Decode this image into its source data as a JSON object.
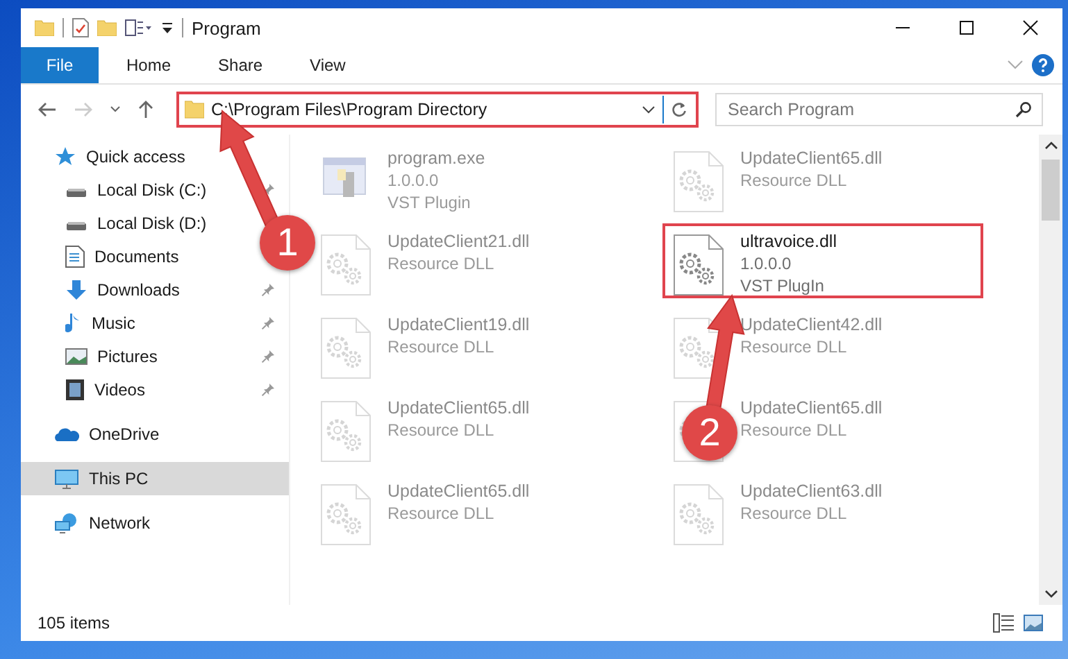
{
  "window": {
    "title": "Program"
  },
  "ribbon_tabs": [
    {
      "label": "File",
      "kind": "file"
    },
    {
      "label": "Home",
      "kind": "tab"
    },
    {
      "label": "Share",
      "kind": "tab"
    },
    {
      "label": "View",
      "kind": "tab"
    }
  ],
  "address_bar": {
    "path": "C:\\Program Files\\Program Directory",
    "highlighted": true
  },
  "search": {
    "placeholder": "Search Program"
  },
  "sidebar": {
    "items": [
      {
        "label": "Quick access",
        "kind": "star",
        "children": [
          {
            "label": "Local Disk (C:)",
            "kind": "disk",
            "pinned": true
          },
          {
            "label": "Local Disk (D:)",
            "kind": "disk",
            "pinned": false
          },
          {
            "label": "Documents",
            "kind": "documents",
            "pinned": false
          },
          {
            "label": "Downloads",
            "kind": "downloads",
            "pinned": true
          },
          {
            "label": "Music",
            "kind": "music",
            "pinned": true
          },
          {
            "label": "Pictures",
            "kind": "pictures",
            "pinned": true
          },
          {
            "label": "Videos",
            "kind": "videos",
            "pinned": true
          }
        ],
        "selected": false
      },
      {
        "label": "OneDrive",
        "kind": "cloud",
        "selected": false
      },
      {
        "label": "This PC",
        "kind": "pc",
        "selected": true
      },
      {
        "label": "Network",
        "kind": "network",
        "selected": false
      }
    ]
  },
  "files": [
    {
      "name": "program.exe",
      "lines": [
        "1.0.0.0",
        "VST Plugin"
      ],
      "kind": "exe",
      "dimmed": true,
      "highlighted": false
    },
    {
      "name": "UpdateClient65.dll",
      "lines": [
        "Resource DLL"
      ],
      "kind": "dll",
      "dimmed": true,
      "highlighted": false
    },
    {
      "name": "UpdateClient21.dll",
      "lines": [
        "Resource DLL"
      ],
      "kind": "dll",
      "dimmed": true,
      "highlighted": false
    },
    {
      "name": "ultravoice.dll",
      "lines": [
        "1.0.0.0",
        "VST PlugIn"
      ],
      "kind": "dll",
      "dimmed": false,
      "highlighted": true
    },
    {
      "name": "UpdateClient19.dll",
      "lines": [
        "Resource DLL"
      ],
      "kind": "dll",
      "dimmed": true,
      "highlighted": false
    },
    {
      "name": "UpdateClient42.dll",
      "lines": [
        "Resource DLL"
      ],
      "kind": "dll",
      "dimmed": true,
      "highlighted": false
    },
    {
      "name": "UpdateClient65.dll",
      "lines": [
        "Resource DLL"
      ],
      "kind": "dll",
      "dimmed": true,
      "highlighted": false
    },
    {
      "name": "UpdateClient65.dll",
      "lines": [
        "Resource DLL"
      ],
      "kind": "dll",
      "dimmed": true,
      "highlighted": false
    },
    {
      "name": "UpdateClient65.dll",
      "lines": [
        "Resource DLL"
      ],
      "kind": "dll",
      "dimmed": true,
      "highlighted": false
    },
    {
      "name": "UpdateClient63.dll",
      "lines": [
        "Resource DLL"
      ],
      "kind": "dll",
      "dimmed": true,
      "highlighted": false
    }
  ],
  "status_bar": {
    "item_count": "105 items"
  },
  "callouts": [
    {
      "number": "1"
    },
    {
      "number": "2"
    }
  ]
}
